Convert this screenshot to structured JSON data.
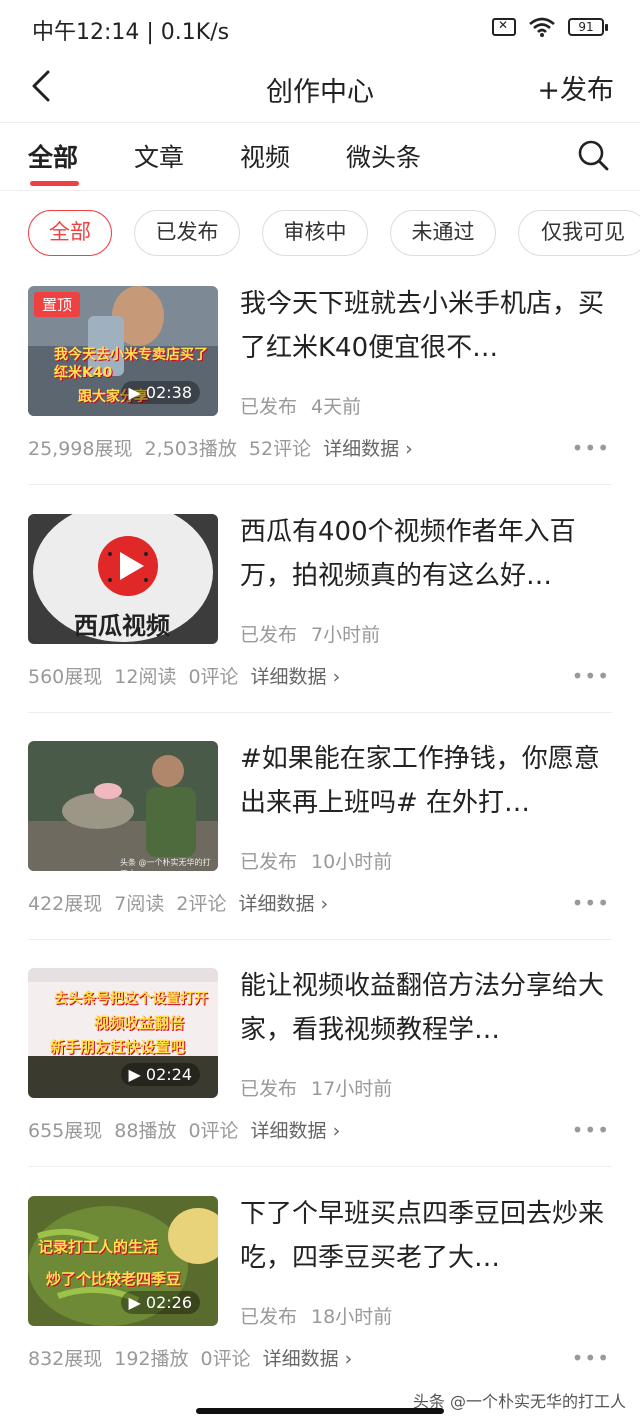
{
  "status_bar": {
    "time": "中午12:14 | 0.1K/s",
    "battery": "91"
  },
  "nav": {
    "title": "创作中心",
    "publish_label": "+发布"
  },
  "tabs": [
    {
      "label": "全部"
    },
    {
      "label": "文章"
    },
    {
      "label": "视频"
    },
    {
      "label": "微头条"
    }
  ],
  "filters": [
    {
      "label": "全部"
    },
    {
      "label": "已发布"
    },
    {
      "label": "审核中"
    },
    {
      "label": "未通过"
    },
    {
      "label": "仅我可见"
    }
  ],
  "items": [
    {
      "title": "我今天下班就去小米手机店，买了红米K40便宜很不…",
      "status": "已发布",
      "time": "4天前",
      "pin": "置顶",
      "duration": "02:38",
      "stats": [
        "25,998展现",
        "2,503播放",
        "52评论"
      ],
      "detail": "详细数据 ›",
      "thumb_text": [
        "我今天去小米专卖店买了个",
        "红米K40",
        "跟大家分享"
      ]
    },
    {
      "title": "西瓜有400个视频作者年入百万，拍视频真的有这么好…",
      "status": "已发布",
      "time": "7小时前",
      "stats": [
        "560展现",
        "12阅读",
        "0评论"
      ],
      "detail": "详细数据 ›",
      "thumb_text": [
        "西瓜视频"
      ]
    },
    {
      "title": "#如果能在家工作挣钱，你愿意出来再上班吗# 在外打…",
      "status": "已发布",
      "time": "10小时前",
      "stats": [
        "422展现",
        "7阅读",
        "2评论"
      ],
      "detail": "详细数据 ›",
      "thumb_text": [
        "头条 @一个朴实无华的打工人"
      ]
    },
    {
      "title": "能让视频收益翻倍方法分享给大家，看我视频教程学…",
      "status": "已发布",
      "time": "17小时前",
      "duration": "02:24",
      "stats": [
        "655展现",
        "88播放",
        "0评论"
      ],
      "detail": "详细数据 ›",
      "thumb_text": [
        "去头条号把这个设置打开",
        "视频收益翻倍",
        "新手朋友赶快设置吧"
      ]
    },
    {
      "title": "下了个早班买点四季豆回去炒来吃，四季豆买老了大…",
      "status": "已发布",
      "time": "18小时前",
      "duration": "02:26",
      "stats": [
        "832展现",
        "192播放",
        "0评论"
      ],
      "detail": "详细数据 ›",
      "thumb_text": [
        "记录打工人的生活",
        "炒了个比较老四季豆"
      ]
    }
  ],
  "watermark": "头条 @一个朴实无华的打工人",
  "colors": {
    "accent": "#f04142",
    "muted_text": "#999999"
  }
}
